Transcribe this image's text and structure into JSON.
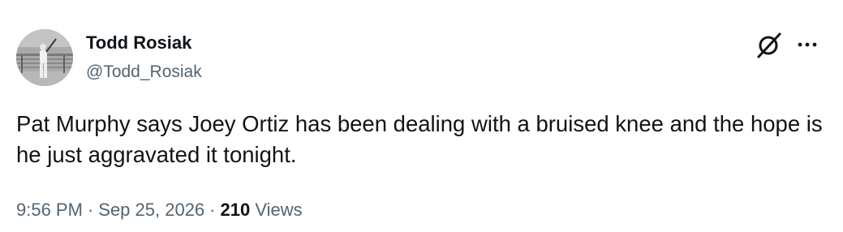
{
  "author": {
    "display_name": "Todd Rosiak",
    "handle": "@Todd_Rosiak"
  },
  "tweet": {
    "text": "Pat Murphy says Joey Ortiz has been dealing with a bruised knee and the hope is he just aggravated it tonight.",
    "time": "9:56 PM",
    "date": "Sep 25, 2026",
    "separator": "·",
    "views_count": "210",
    "views_label": "Views"
  },
  "icons": {
    "grok": "grok-icon",
    "more": "more-icon",
    "avatar": "baseball-player-photo"
  },
  "colors": {
    "primary_text": "#0f1419",
    "secondary_text": "#536471",
    "background": "#ffffff"
  }
}
